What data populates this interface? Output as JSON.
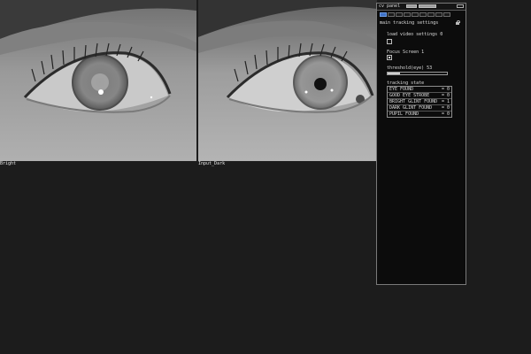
{
  "views": {
    "left_caption": "Bright",
    "right_caption": "Input_Dark"
  },
  "panel": {
    "title": "cv panel",
    "section_title": "main tracking settings",
    "load_video_label": "load video settings 0",
    "focus_screen_label": "Focus Screen 1",
    "threshold_label": "threshold(eye) 53",
    "threshold_fraction": 0.21,
    "tracking_state_label": "tracking state",
    "tracking_rows": [
      {
        "name": "EYE FOUND",
        "value": "= 0"
      },
      {
        "name": "GOOD EYE STROBE",
        "value": "= 0"
      },
      {
        "name": "BRIGHT GLINT FOUND",
        "value": "= 1"
      },
      {
        "name": "DARK GLINT FOUND",
        "value": "= 0"
      },
      {
        "name": "PUPIL FOUND",
        "value": "= 0"
      }
    ]
  }
}
